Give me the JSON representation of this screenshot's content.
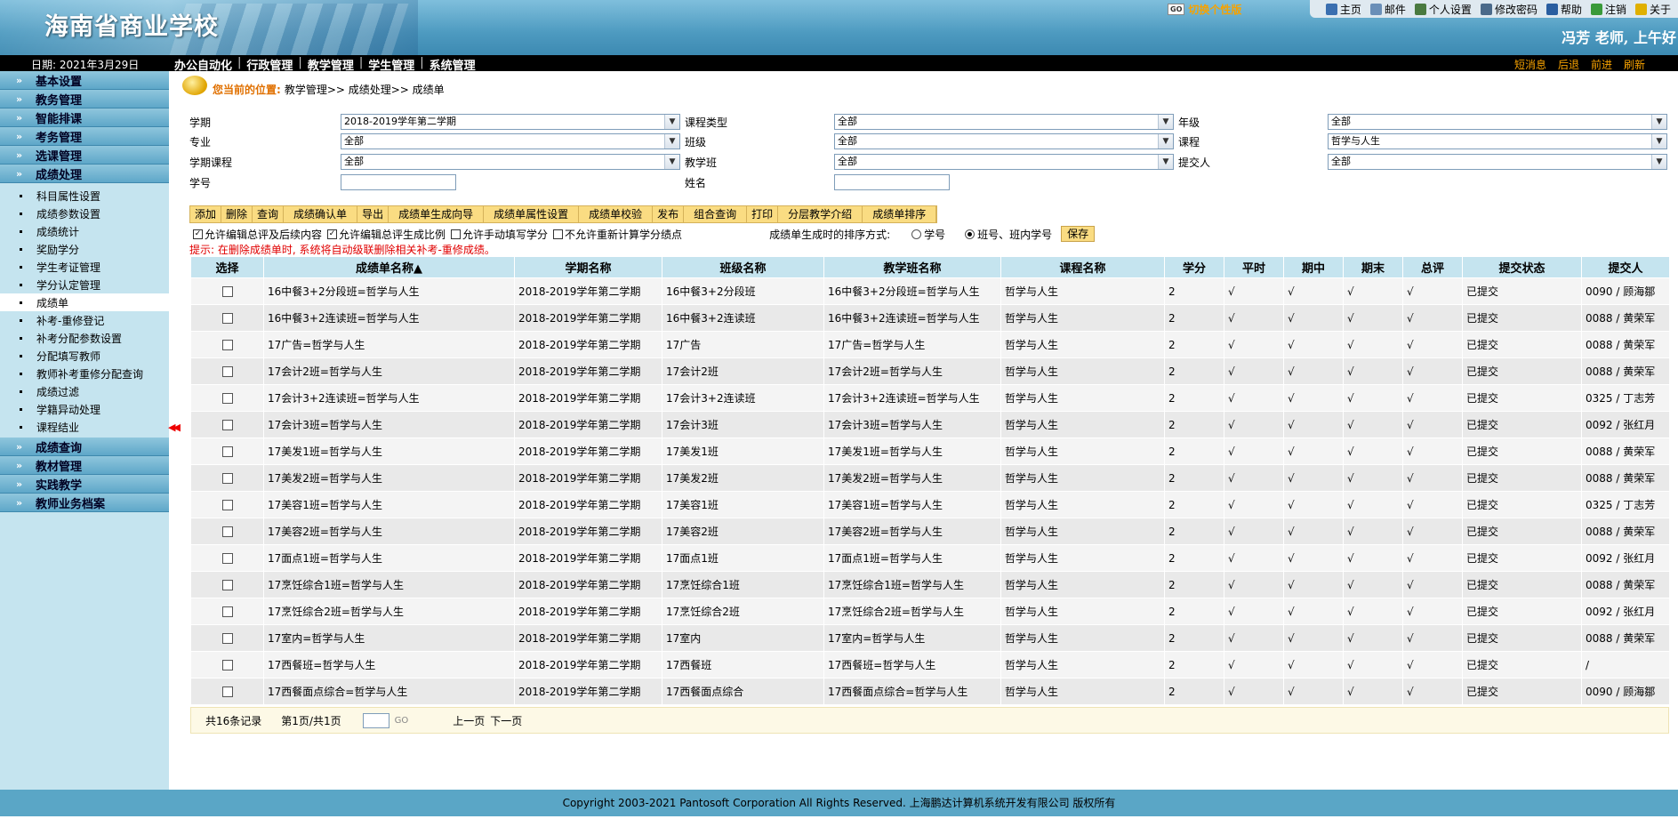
{
  "header": {
    "school_name": "海南省商业学校",
    "switch_label": "切换个性版",
    "switch_go": "GO",
    "top_links": [
      {
        "label": "主页",
        "icon": "home-icon",
        "color": "#3a6fb0"
      },
      {
        "label": "邮件",
        "icon": "mail-icon",
        "color": "#6a8fb8"
      },
      {
        "label": "个人设置",
        "icon": "user-icon",
        "color": "#4a7a40"
      },
      {
        "label": "修改密码",
        "icon": "key-icon",
        "color": "#4b6a8a"
      },
      {
        "label": "帮助",
        "icon": "help-icon",
        "color": "#2a5ea0"
      },
      {
        "label": "注销",
        "icon": "logout-icon",
        "color": "#3a9a3a"
      },
      {
        "label": "关于",
        "icon": "info-icon",
        "color": "#e0b000"
      }
    ],
    "greeting": "冯芳  老师,   上午好"
  },
  "navbar": {
    "date": "日期: 2021年3月29日",
    "menus": [
      "办公自动化",
      "行政管理",
      "教学管理",
      "学生管理",
      "系统管理"
    ],
    "right_links": [
      "短消息",
      "后退",
      "前进",
      "刷新"
    ]
  },
  "sidebar": {
    "groups_top": [
      "基本设置",
      "教务管理",
      "智能排课",
      "考务管理",
      "选课管理",
      "成绩处理"
    ],
    "sub_items": [
      "科目属性设置",
      "成绩参数设置",
      "成绩统计",
      "奖励学分",
      "学生考证管理",
      "学分认定管理",
      "成绩单",
      "补考-重修登记",
      "补考分配参数设置",
      "分配填写教师",
      "教师补考重修分配查询",
      "成绩过滤",
      "学籍异动处理",
      "课程结业"
    ],
    "active_sub": "成绩单",
    "groups_bottom": [
      "成绩查询",
      "教材管理",
      "实践教学",
      "教师业务档案"
    ]
  },
  "breadcrumb": {
    "label": "您当前的位置:",
    "path": "教学管理>> 成绩处理>> 成绩单"
  },
  "filters": {
    "semester_label": "学期",
    "semester_value": "2018-2019学年第二学期",
    "course_type_label": "课程类型",
    "course_type_value": "全部",
    "grade_label": "年级",
    "grade_value": "全部",
    "major_label": "专业",
    "major_value": "全部",
    "class_label": "班级",
    "class_value": "全部",
    "course_label": "课程",
    "course_value": "哲学与人生",
    "term_course_label": "学期课程",
    "term_course_value": "全部",
    "teaching_class_label": "教学班",
    "teaching_class_value": "全部",
    "submitter_label": "提交人",
    "submitter_value": "全部",
    "student_no_label": "学号",
    "name_label": "姓名"
  },
  "toolbar": [
    "添加",
    "删除",
    "查询",
    "成绩确认单",
    "导出",
    "成绩单生成向导",
    "成绩单属性设置",
    "成绩单校验",
    "发布",
    "组合查询",
    "打印",
    "分层教学介绍",
    "成绩单排序"
  ],
  "options": {
    "opt1": "允许编辑总评及后续内容",
    "opt2": "允许编辑总评生成比例",
    "opt3": "允许手动填写学分",
    "opt4": "不允许重新计算学分绩点",
    "sort_label": "成绩单生成时的排序方式:",
    "sort_opt1": "学号",
    "sort_opt2": "班号、班内学号",
    "save": "保存"
  },
  "hint": "提示: 在删除成绩单时, 系统将自动级联删除相关补考-重修成绩。",
  "table": {
    "headers": [
      "选择",
      "成绩单名称▲",
      "学期名称",
      "班级名称",
      "教学班名称",
      "课程名称",
      "学分",
      "平时",
      "期中",
      "期末",
      "总评",
      "提交状态",
      "提交人"
    ],
    "rows": [
      [
        "16中餐3+2分段班=哲学与人生",
        "2018-2019学年第二学期",
        "16中餐3+2分段班",
        "16中餐3+2分段班=哲学与人生",
        "哲学与人生",
        "2",
        "√",
        "√",
        "√",
        "√",
        "已提交",
        "0090 / 顾海鄒"
      ],
      [
        "16中餐3+2连读班=哲学与人生",
        "2018-2019学年第二学期",
        "16中餐3+2连读班",
        "16中餐3+2连读班=哲学与人生",
        "哲学与人生",
        "2",
        "√",
        "√",
        "√",
        "√",
        "已提交",
        "0088 / 黄荣军"
      ],
      [
        "17广告=哲学与人生",
        "2018-2019学年第二学期",
        "17广告",
        "17广告=哲学与人生",
        "哲学与人生",
        "2",
        "√",
        "√",
        "√",
        "√",
        "已提交",
        "0088 / 黄荣军"
      ],
      [
        "17会计2班=哲学与人生",
        "2018-2019学年第二学期",
        "17会计2班",
        "17会计2班=哲学与人生",
        "哲学与人生",
        "2",
        "√",
        "√",
        "√",
        "√",
        "已提交",
        "0088 / 黄荣军"
      ],
      [
        "17会计3+2连读班=哲学与人生",
        "2018-2019学年第二学期",
        "17会计3+2连读班",
        "17会计3+2连读班=哲学与人生",
        "哲学与人生",
        "2",
        "√",
        "√",
        "√",
        "√",
        "已提交",
        "0325 / 丁志芳"
      ],
      [
        "17会计3班=哲学与人生",
        "2018-2019学年第二学期",
        "17会计3班",
        "17会计3班=哲学与人生",
        "哲学与人生",
        "2",
        "√",
        "√",
        "√",
        "√",
        "已提交",
        "0092 / 张红月"
      ],
      [
        "17美发1班=哲学与人生",
        "2018-2019学年第二学期",
        "17美发1班",
        "17美发1班=哲学与人生",
        "哲学与人生",
        "2",
        "√",
        "√",
        "√",
        "√",
        "已提交",
        "0088 / 黄荣军"
      ],
      [
        "17美发2班=哲学与人生",
        "2018-2019学年第二学期",
        "17美发2班",
        "17美发2班=哲学与人生",
        "哲学与人生",
        "2",
        "√",
        "√",
        "√",
        "√",
        "已提交",
        "0088 / 黄荣军"
      ],
      [
        "17美容1班=哲学与人生",
        "2018-2019学年第二学期",
        "17美容1班",
        "17美容1班=哲学与人生",
        "哲学与人生",
        "2",
        "√",
        "√",
        "√",
        "√",
        "已提交",
        "0325 / 丁志芳"
      ],
      [
        "17美容2班=哲学与人生",
        "2018-2019学年第二学期",
        "17美容2班",
        "17美容2班=哲学与人生",
        "哲学与人生",
        "2",
        "√",
        "√",
        "√",
        "√",
        "已提交",
        "0088 / 黄荣军"
      ],
      [
        "17面点1班=哲学与人生",
        "2018-2019学年第二学期",
        "17面点1班",
        "17面点1班=哲学与人生",
        "哲学与人生",
        "2",
        "√",
        "√",
        "√",
        "√",
        "已提交",
        "0092 / 张红月"
      ],
      [
        "17烹饪综合1班=哲学与人生",
        "2018-2019学年第二学期",
        "17烹饪综合1班",
        "17烹饪综合1班=哲学与人生",
        "哲学与人生",
        "2",
        "√",
        "√",
        "√",
        "√",
        "已提交",
        "0088 / 黄荣军"
      ],
      [
        "17烹饪综合2班=哲学与人生",
        "2018-2019学年第二学期",
        "17烹饪综合2班",
        "17烹饪综合2班=哲学与人生",
        "哲学与人生",
        "2",
        "√",
        "√",
        "√",
        "√",
        "已提交",
        "0092 / 张红月"
      ],
      [
        "17室内=哲学与人生",
        "2018-2019学年第二学期",
        "17室内",
        "17室内=哲学与人生",
        "哲学与人生",
        "2",
        "√",
        "√",
        "√",
        "√",
        "已提交",
        "0088 / 黄荣军"
      ],
      [
        "17西餐班=哲学与人生",
        "2018-2019学年第二学期",
        "17西餐班",
        "17西餐班=哲学与人生",
        "哲学与人生",
        "2",
        "√",
        "√",
        "√",
        "√",
        "已提交",
        "/"
      ],
      [
        "17西餐面点综合=哲学与人生",
        "2018-2019学年第二学期",
        "17西餐面点综合",
        "17西餐面点综合=哲学与人生",
        "哲学与人生",
        "2",
        "√",
        "√",
        "√",
        "√",
        "已提交",
        "0090 / 顾海鄒"
      ]
    ]
  },
  "pager": {
    "total": "共16条记录",
    "page": "第1页/共1页",
    "go": "GO",
    "prev": "上一页",
    "next": "下一页"
  },
  "footer": "Copyright 2003-2021 Pantosoft Corporation All Rights Reserved. 上海鹏达计算机系统开发有限公司  版权所有"
}
